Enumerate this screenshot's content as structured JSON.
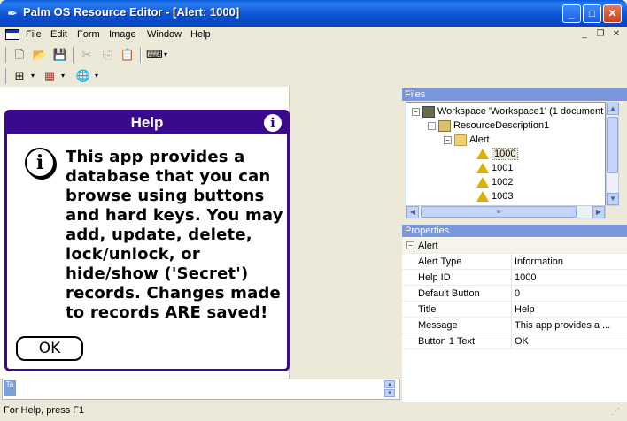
{
  "window": {
    "title": "Palm OS Resource Editor - [Alert: 1000]",
    "app_icon": "quill-pen-icon",
    "controls": {
      "minimize": "_",
      "maximize": "□",
      "close": "✕"
    }
  },
  "menubar": {
    "items": [
      "File",
      "Edit",
      "Form",
      "Image",
      "Window",
      "Help"
    ],
    "mdi_controls": {
      "minimize": "_",
      "restore": "❐",
      "close": "✕"
    }
  },
  "toolbar1": {
    "icons": [
      "new-icon",
      "open-icon",
      "save-icon",
      "cut-icon",
      "copy-icon",
      "paste-icon",
      "keyboard-icon"
    ],
    "glyphs": {
      "new": "🗋",
      "open": "📂",
      "save": "💾",
      "cut": "✂",
      "copy": "⎘",
      "paste": "📋",
      "keyboard": "⌨",
      "dropdown": "▾"
    }
  },
  "toolbar2": {
    "icons": [
      "layout-icon",
      "color-palette-icon",
      "globe-icon"
    ],
    "glyphs": {
      "layout": "⊞",
      "color": "▦",
      "globe": "🌐",
      "dropdown": "▾"
    }
  },
  "palm_dialog": {
    "title": "Help",
    "info_glyph": "i",
    "message": "This app provides a\ndatabase that you can\nbrowse using buttons\nand hard keys.  You may\nadd, update, delete,\nlock/unlock, or\nhide/show ('Secret')\nrecords.  Changes made\nto records ARE saved!",
    "button_label": "OK",
    "accent_color": "#3a0a8c"
  },
  "files_pane": {
    "header": "Files",
    "tree": {
      "workspace": {
        "expander": "−",
        "label": "Workspace 'Workspace1' (1 document"
      },
      "resource": {
        "expander": "−",
        "label": "ResourceDescription1"
      },
      "folder": {
        "expander": "−",
        "label": "Alert"
      },
      "items": [
        "1000",
        "1001",
        "1002",
        "1003"
      ],
      "selected": "1000"
    },
    "scroll_glyphs": {
      "up": "▲",
      "down": "▼",
      "left": "◀",
      "right": "▶",
      "grip": "≡"
    }
  },
  "properties_pane": {
    "header": "Properties",
    "group": {
      "expander": "−",
      "label": "Alert"
    },
    "rows": [
      {
        "key": "Alert Type",
        "value": "Information"
      },
      {
        "key": "Help ID",
        "value": "1000"
      },
      {
        "key": "Default Button",
        "value": "0"
      },
      {
        "key": "Title",
        "value": "Help"
      },
      {
        "key": "Message",
        "value": "This app provides a ..."
      },
      {
        "key": "Button 1 Text",
        "value": "OK"
      }
    ]
  },
  "bottom_tab": {
    "label": "Ta"
  },
  "statusbar": {
    "text": "For Help, press F1"
  }
}
